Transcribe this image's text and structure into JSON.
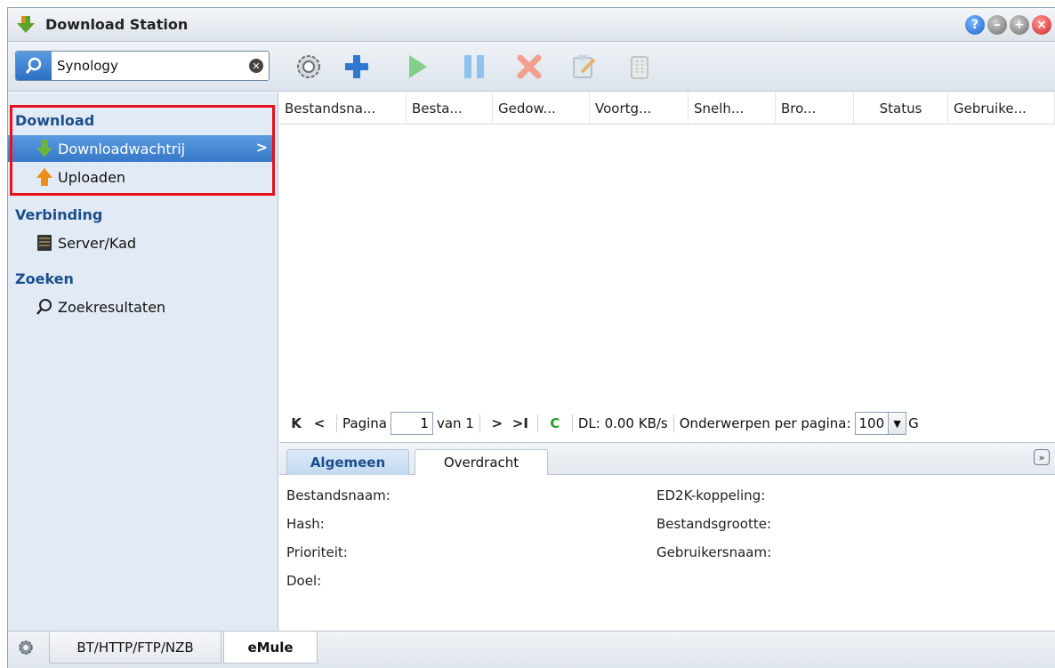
{
  "window": {
    "title": "Download Station",
    "title_icon": "download-station-icon",
    "buttons": [
      "help-icon",
      "minimize-icon",
      "maximize-icon",
      "close-icon"
    ]
  },
  "search": {
    "value": "Synology",
    "clear_glyph": "✕"
  },
  "toolbar": {
    "buttons": [
      "settings-icon",
      "add-icon",
      "resume-icon",
      "pause-icon",
      "delete-icon",
      "edit-icon",
      "clear-icon"
    ]
  },
  "sidebar": {
    "sections": [
      {
        "label": "Download",
        "items": [
          "Downloadwachtrij",
          "Uploaden"
        ]
      },
      {
        "label": "Verbinding",
        "items": [
          "Server/Kad"
        ]
      },
      {
        "label": "Zoeken",
        "items": [
          "Zoekresultaten"
        ]
      }
    ],
    "selected_item": "Downloadwachtrij",
    "selected_arrow": ">"
  },
  "grid": {
    "columns": [
      "Bestandsna...",
      "Besta...",
      "Gedow...",
      "Voortg...",
      "Snelh...",
      "Bro...",
      "Status",
      "Gebruike..."
    ]
  },
  "pager": {
    "first": "K",
    "prev": "<",
    "page_label": "Pagina",
    "page_value": "1",
    "of_label": "van 1",
    "next": ">",
    "last": ">I",
    "refresh_glyph": "C",
    "dl_rate": "DL: 0.00 KB/s",
    "per_page_label": "Onderwerpen per pagina:",
    "per_page_value": "100",
    "trailing": "G"
  },
  "detail": {
    "tabs": [
      "Algemeen",
      "Overdracht"
    ],
    "active_tab": "Algemeen",
    "left_fields": [
      "Bestandsnaam:",
      "Hash:",
      "Prioriteit:",
      "Doel:"
    ],
    "right_fields": [
      "ED2K-koppeling:",
      "Bestandsgrootte:",
      "Gebruikersnaam:"
    ]
  },
  "bottom_tabs": {
    "tabs": [
      "BT/HTTP/FTP/NZB",
      "eMule"
    ],
    "active": "eMule"
  },
  "colors": {
    "accent": "#3778c8",
    "section_heading": "#1a4f8c",
    "highlight_border": "#e8101a",
    "sidebar_bg": "#e2ebf5"
  }
}
